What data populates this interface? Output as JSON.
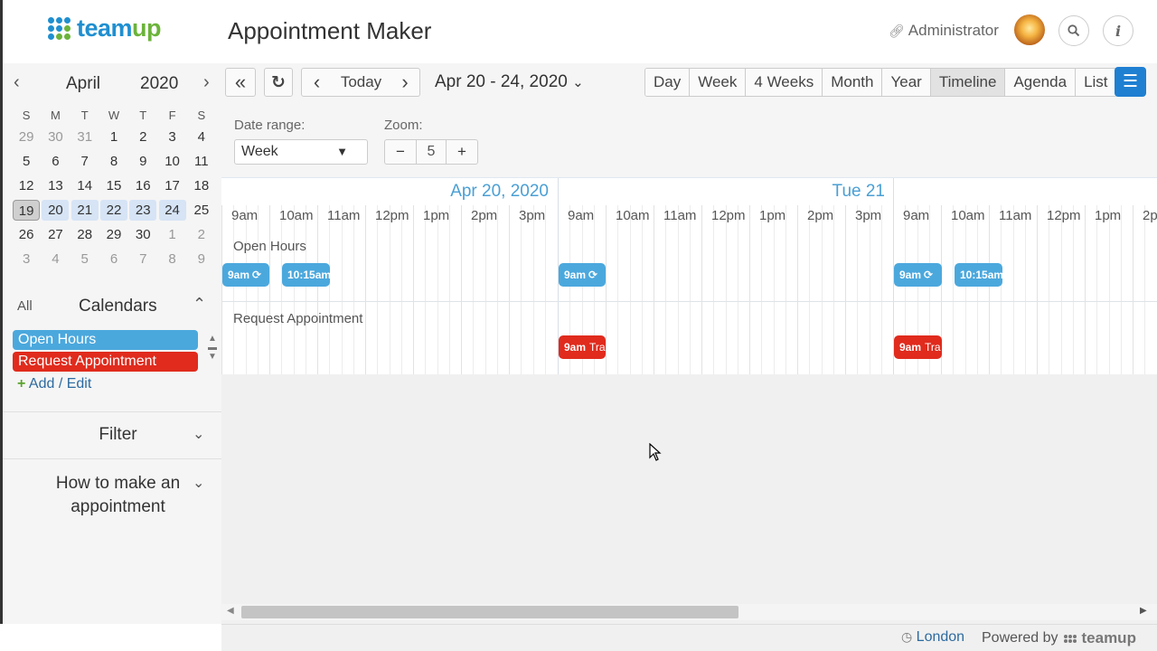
{
  "header": {
    "logo_text_a": "team",
    "logo_text_b": "up",
    "title": "Appointment Maker",
    "user": "Administrator",
    "search_icon": "search-icon",
    "info_icon": "info-icon"
  },
  "mini_calendar": {
    "month": "April",
    "year": "2020",
    "weekdays": [
      "S",
      "M",
      "T",
      "W",
      "T",
      "F",
      "S"
    ],
    "weeks": [
      [
        "29",
        "30",
        "31",
        "1",
        "2",
        "3",
        "4"
      ],
      [
        "5",
        "6",
        "7",
        "8",
        "9",
        "10",
        "11"
      ],
      [
        "12",
        "13",
        "14",
        "15",
        "16",
        "17",
        "18"
      ],
      [
        "19",
        "20",
        "21",
        "22",
        "23",
        "24",
        "25"
      ],
      [
        "26",
        "27",
        "28",
        "29",
        "30",
        "1",
        "2"
      ],
      [
        "3",
        "4",
        "5",
        "6",
        "7",
        "8",
        "9"
      ]
    ]
  },
  "calendars": {
    "all_label": "All",
    "title": "Calendars",
    "items": [
      {
        "label": "Open Hours",
        "color": "#4ba8dd"
      },
      {
        "label": "Request Appointment",
        "color": "#e02b1d"
      }
    ],
    "add_edit": "Add / Edit",
    "add_symbol": "+"
  },
  "sections": {
    "filter": "Filter",
    "howto": "How to make an appointment"
  },
  "toolbar": {
    "today": "Today",
    "date_range": "Apr 20 - 24, 2020",
    "views": [
      "Day",
      "Week",
      "4 Weeks",
      "Month",
      "Year",
      "Timeline",
      "Agenda",
      "List"
    ],
    "active_view": "Timeline"
  },
  "controls": {
    "date_range_label": "Date range:",
    "date_range_value": "Week",
    "zoom_label": "Zoom:",
    "zoom_value": "5",
    "zoom_minus": "−",
    "zoom_plus": "+"
  },
  "timeline": {
    "days": [
      {
        "label": "Apr 20, 2020"
      },
      {
        "label": "Tue 21"
      }
    ],
    "hours_day1": [
      "9am",
      "10am",
      "11am",
      "12pm",
      "1pm",
      "2pm",
      "3pm"
    ],
    "hours_day2": [
      "9am",
      "10am",
      "11am",
      "12pm",
      "1pm",
      "2pm",
      "3pm"
    ],
    "hours_day3": [
      "9am",
      "10am",
      "11am",
      "12pm",
      "1pm",
      "2p"
    ],
    "groups": [
      "Open Hours",
      "Request Appointment"
    ],
    "events_open": [
      {
        "time": "9am"
      },
      {
        "time": "10:15am"
      },
      {
        "time": "9am"
      },
      {
        "time": "9am"
      },
      {
        "time": "10:15am"
      }
    ],
    "events_request": [
      {
        "time": "9am",
        "title": "Tra"
      },
      {
        "time": "9am",
        "title": "Tra"
      }
    ]
  },
  "footer": {
    "timezone": "London",
    "powered_by": "Powered by",
    "brand": "teamup"
  }
}
